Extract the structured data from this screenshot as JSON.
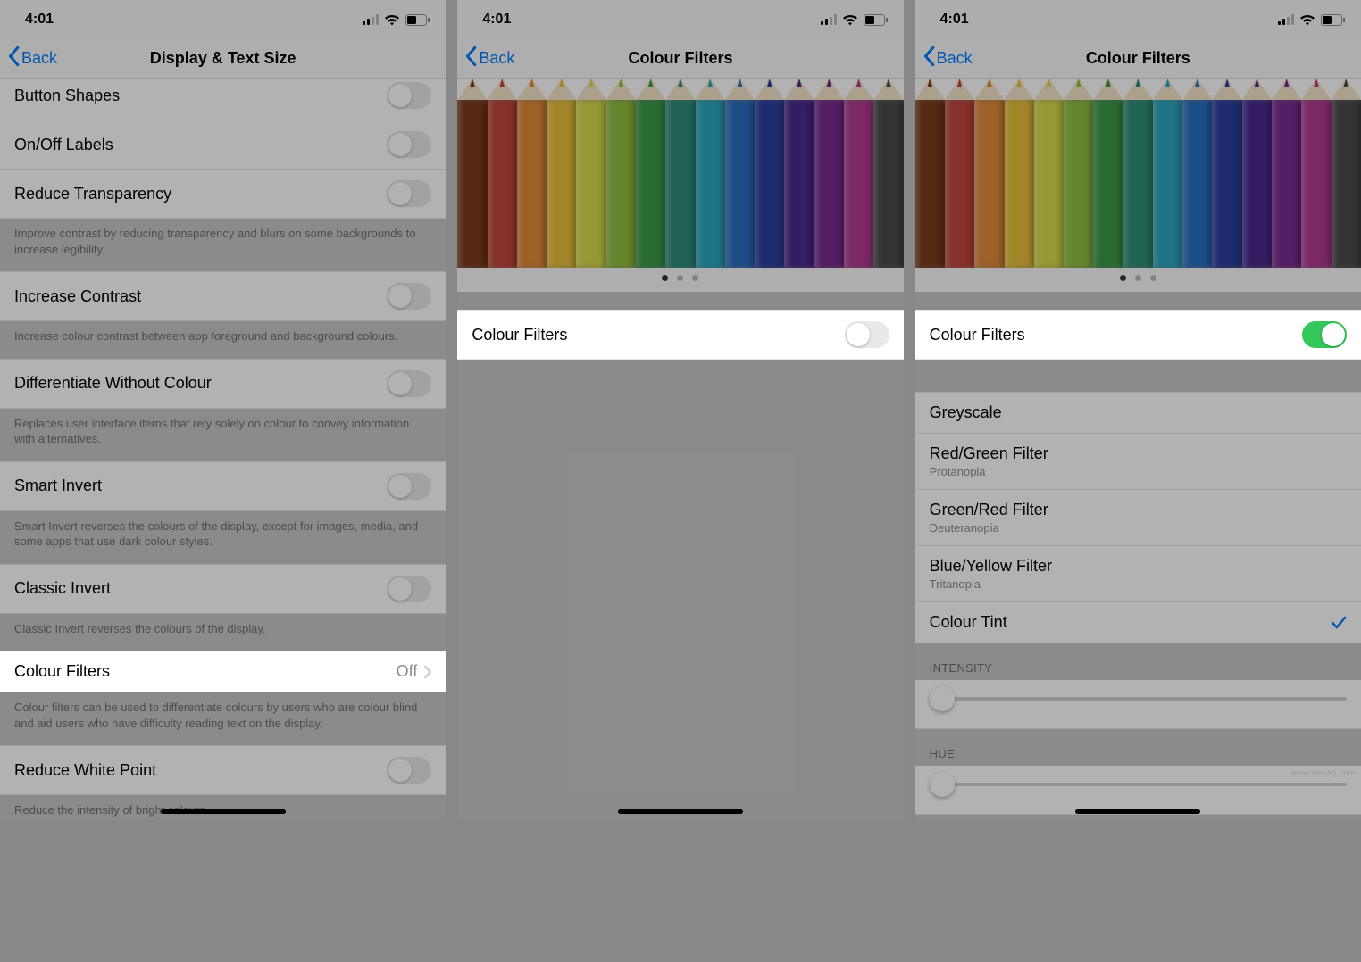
{
  "status": {
    "time": "4:01"
  },
  "screen1": {
    "back": "Back",
    "title": "Display & Text Size",
    "items": {
      "button_shapes": "Button Shapes",
      "onoff_labels": "On/Off Labels",
      "reduce_transparency": "Reduce Transparency",
      "reduce_transparency_footer": "Improve contrast by reducing transparency and blurs on some backgrounds to increase legibility.",
      "increase_contrast": "Increase Contrast",
      "increase_contrast_footer": "Increase colour contrast between app foreground and background colours.",
      "diff_without_colour": "Differentiate Without Colour",
      "diff_without_colour_footer": "Replaces user interface items that rely solely on colour to convey information with alternatives.",
      "smart_invert": "Smart Invert",
      "smart_invert_footer": "Smart Invert reverses the colours of the display, except for images, media, and some apps that use dark colour styles.",
      "classic_invert": "Classic Invert",
      "classic_invert_footer": "Classic Invert reverses the colours of the display.",
      "colour_filters": "Colour Filters",
      "colour_filters_value": "Off",
      "colour_filters_footer": "Colour filters can be used to differentiate colours by users who are colour blind and aid users who have difficulty reading text on the display.",
      "reduce_white_point": "Reduce White Point",
      "reduce_white_point_footer": "Reduce the intensity of bright colours."
    }
  },
  "screen2": {
    "back": "Back",
    "title": "Colour Filters",
    "toggle_label": "Colour Filters"
  },
  "screen3": {
    "back": "Back",
    "title": "Colour Filters",
    "toggle_label": "Colour Filters",
    "filters": {
      "greyscale": "Greyscale",
      "red_green": "Red/Green Filter",
      "red_green_sub": "Protanopia",
      "green_red": "Green/Red Filter",
      "green_red_sub": "Deuteranopia",
      "blue_yellow": "Blue/Yellow Filter",
      "blue_yellow_sub": "Tritanopia",
      "colour_tint": "Colour Tint"
    },
    "intensity_label": "INTENSITY",
    "hue_label": "HUE"
  },
  "pencil_colors": [
    "#7a3b1a",
    "#c1473b",
    "#e08a3a",
    "#e8c23a",
    "#d7db4a",
    "#8fbf3f",
    "#3a9a4a",
    "#2f8f7a",
    "#2aa7bf",
    "#2a6fbf",
    "#2a3f9f",
    "#4a2a8f",
    "#7a2a8f",
    "#b03a8f",
    "#4a4a4a"
  ],
  "watermark": "www.deuaq.com"
}
